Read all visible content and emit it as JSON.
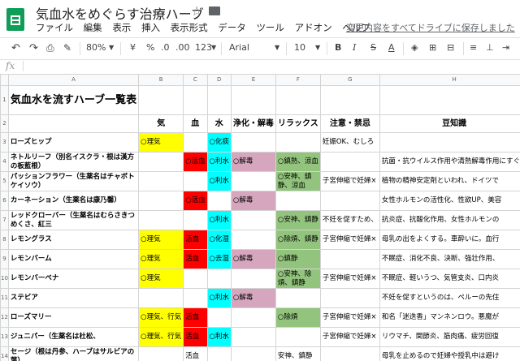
{
  "doc": {
    "title": "気血水をめぐらす治療ハーブ",
    "save_note": "変更内容をすべてドライブに保存しました"
  },
  "menu": [
    "ファイル",
    "編集",
    "表示",
    "挿入",
    "表示形式",
    "データ",
    "ツール",
    "アドオン",
    "ヘルプ"
  ],
  "toolbar": {
    "zoom": "80%",
    "currency": "¥",
    "percent": "%",
    "dec_less": ".0",
    "dec_more": ".00",
    "format": "123",
    "font": "Arial",
    "size": "10",
    "bold": "B",
    "italic": "I",
    "strike": "S",
    "textcolor": "A"
  },
  "formula": {
    "fx": "fx"
  },
  "columns": [
    "A",
    "B",
    "C",
    "D",
    "E",
    "F",
    "G",
    "H",
    "I",
    "J",
    "K"
  ],
  "rows": [
    {
      "num": "1",
      "cells": [
        {
          "t": "気血水を流すハーブ一覧表",
          "cls": "title"
        },
        {
          "t": ""
        },
        {
          "t": ""
        },
        {
          "t": ""
        },
        {
          "t": ""
        },
        {
          "t": ""
        },
        {
          "t": ""
        },
        {
          "t": ""
        },
        {
          "t": ""
        }
      ]
    },
    {
      "num": "2",
      "cells": [
        {
          "t": ""
        },
        {
          "t": "気",
          "cls": "colhdr"
        },
        {
          "t": "血",
          "cls": "colhdr"
        },
        {
          "t": "水",
          "cls": "colhdr"
        },
        {
          "t": "浄化・解毒",
          "cls": "colhdr"
        },
        {
          "t": "リラックス",
          "cls": "colhdr"
        },
        {
          "t": "注意・禁忌",
          "cls": "colhdr"
        },
        {
          "t": "豆知識",
          "cls": "colhdr"
        },
        {
          "t": ""
        }
      ]
    },
    {
      "num": "3",
      "cells": [
        {
          "t": "ローズヒップ",
          "cls": "name"
        },
        {
          "t": "○理気",
          "cls": "y"
        },
        {
          "t": ""
        },
        {
          "t": "○化痰",
          "cls": "c"
        },
        {
          "t": ""
        },
        {
          "t": ""
        },
        {
          "t": "妊娠OK、むしろ"
        },
        {
          "t": ""
        },
        {
          "t": "解鬱、月経不順、咳、乳腺炎、腹痛"
        }
      ]
    },
    {
      "num": "4",
      "cells": [
        {
          "t": "ネトルリーフ（別名イスクラ・根は漢方の板藍根）",
          "cls": "name"
        },
        {
          "t": ""
        },
        {
          "t": "○活血",
          "cls": "r"
        },
        {
          "t": "○利水",
          "cls": "c"
        },
        {
          "t": "○解毒",
          "cls": "p"
        },
        {
          "t": "○鎮熱、涼血",
          "cls": "g"
        },
        {
          "t": ""
        },
        {
          "t": "抗菌・抗ウイルス作用や清熱解毒作用にすぐれ"
        },
        {
          "t": ""
        }
      ]
    },
    {
      "num": "5",
      "cells": [
        {
          "t": "パッションフラワー（生薬名はチャボトケイソウ）",
          "cls": "name"
        },
        {
          "t": ""
        },
        {
          "t": ""
        },
        {
          "t": "○利水",
          "cls": "c"
        },
        {
          "t": ""
        },
        {
          "t": "○安神、鎮静、涼血",
          "cls": "g wrap"
        },
        {
          "t": "子宮伸縮で妊婦×"
        },
        {
          "t": "植物の精神安定剤といわれ、ドイツで"
        },
        {
          "t": ""
        }
      ]
    },
    {
      "num": "6",
      "cells": [
        {
          "t": "カーネーション（生薬名は康乃馨）",
          "cls": "name"
        },
        {
          "t": ""
        },
        {
          "t": "○活血",
          "cls": "r"
        },
        {
          "t": ""
        },
        {
          "t": "○解毒",
          "cls": "p"
        },
        {
          "t": ""
        },
        {
          "t": ""
        },
        {
          "t": "女性ホルモンの活性化、性欲UP、美容"
        },
        {
          "t": ""
        }
      ]
    },
    {
      "num": "7",
      "cells": [
        {
          "t": "レッドクローバー（生薬名はむらさきつめくさ、紅三",
          "cls": "name"
        },
        {
          "t": ""
        },
        {
          "t": ""
        },
        {
          "t": "○利水",
          "cls": "c"
        },
        {
          "t": ""
        },
        {
          "t": "○安神、鎮静",
          "cls": "g"
        },
        {
          "t": "不妊を促すため、"
        },
        {
          "t": "抗炎症、抗酸化作用、女性ホルモンの"
        },
        {
          "t": ""
        }
      ]
    },
    {
      "num": "8",
      "cells": [
        {
          "t": "レモングラス",
          "cls": "name"
        },
        {
          "t": "○理気",
          "cls": "y"
        },
        {
          "t": "活血",
          "cls": "r"
        },
        {
          "t": "○化湿",
          "cls": "c"
        },
        {
          "t": ""
        },
        {
          "t": "○除煩、鎮静",
          "cls": "g"
        },
        {
          "t": "子宮伸縮で妊婦×"
        },
        {
          "t": "母乳の出をよくする。車酔いに。血行"
        },
        {
          "t": ""
        }
      ]
    },
    {
      "num": "9",
      "cells": [
        {
          "t": "レモンバーム",
          "cls": "name"
        },
        {
          "t": "○理気",
          "cls": "y"
        },
        {
          "t": "活血",
          "cls": "r"
        },
        {
          "t": "○去湿",
          "cls": "c"
        },
        {
          "t": "○解毒",
          "cls": "p"
        },
        {
          "t": "○鎮静",
          "cls": "g"
        },
        {
          "t": ""
        },
        {
          "t": "不眠症、消化不良、決断、強壮作用、"
        },
        {
          "t": ""
        }
      ]
    },
    {
      "num": "10",
      "cells": [
        {
          "t": "レモンバーベナ",
          "cls": "name"
        },
        {
          "t": "○理気",
          "cls": "y"
        },
        {
          "t": ""
        },
        {
          "t": ""
        },
        {
          "t": ""
        },
        {
          "t": "○安神、除煩、鎮静",
          "cls": "g wrap"
        },
        {
          "t": "子宮伸縮で妊婦×"
        },
        {
          "t": "不眠症、軽いうつ、気管支炎、口内炎"
        },
        {
          "t": ""
        }
      ]
    },
    {
      "num": "11",
      "cells": [
        {
          "t": "ステビア",
          "cls": "name"
        },
        {
          "t": ""
        },
        {
          "t": ""
        },
        {
          "t": "○利水",
          "cls": "c"
        },
        {
          "t": "○解毒",
          "cls": "p"
        },
        {
          "t": ""
        },
        {
          "t": ""
        },
        {
          "t": "不妊を促すというのは、ペルーの先住"
        },
        {
          "t": ""
        }
      ]
    },
    {
      "num": "12",
      "cells": [
        {
          "t": "ローズマリー",
          "cls": "name"
        },
        {
          "t": "○理気、行気",
          "cls": "y"
        },
        {
          "t": "活血",
          "cls": "r"
        },
        {
          "t": ""
        },
        {
          "t": ""
        },
        {
          "t": "○除煩",
          "cls": "g"
        },
        {
          "t": "子宮伸縮で妊婦×"
        },
        {
          "t": "和名「迷迭香」マンネンロウ。悪魔が"
        },
        {
          "t": ""
        }
      ]
    },
    {
      "num": "13",
      "cells": [
        {
          "t": "ジュニパー（生薬名は杜松、",
          "cls": "name"
        },
        {
          "t": "○理気、行気",
          "cls": "y"
        },
        {
          "t": "活血",
          "cls": "r"
        },
        {
          "t": "○利水",
          "cls": "c"
        },
        {
          "t": ""
        },
        {
          "t": ""
        },
        {
          "t": "子宮伸縮で妊婦×"
        },
        {
          "t": "リウマチ、関節炎、筋肉痛、疲労回復"
        },
        {
          "t": ""
        }
      ]
    },
    {
      "num": "14",
      "cells": [
        {
          "t": "セージ（根は丹参、ハーブはサルビアの葉）",
          "cls": "name"
        },
        {
          "t": ""
        },
        {
          "t": "活血"
        },
        {
          "t": ""
        },
        {
          "t": ""
        },
        {
          "t": "安神、鎮静"
        },
        {
          "t": ""
        },
        {
          "t": "母乳を止めるので妊婦や授乳中は避け"
        },
        {
          "t": "母乳の分泌を抑える。長寿のハーブ。記憶力回"
        }
      ]
    }
  ],
  "colors": {
    "yellow": "#ffff00",
    "red": "#ff0000",
    "cyan": "#00ffff",
    "pink": "#d5a6bd",
    "green": "#93c47d",
    "sheets": "#0f9d58"
  }
}
